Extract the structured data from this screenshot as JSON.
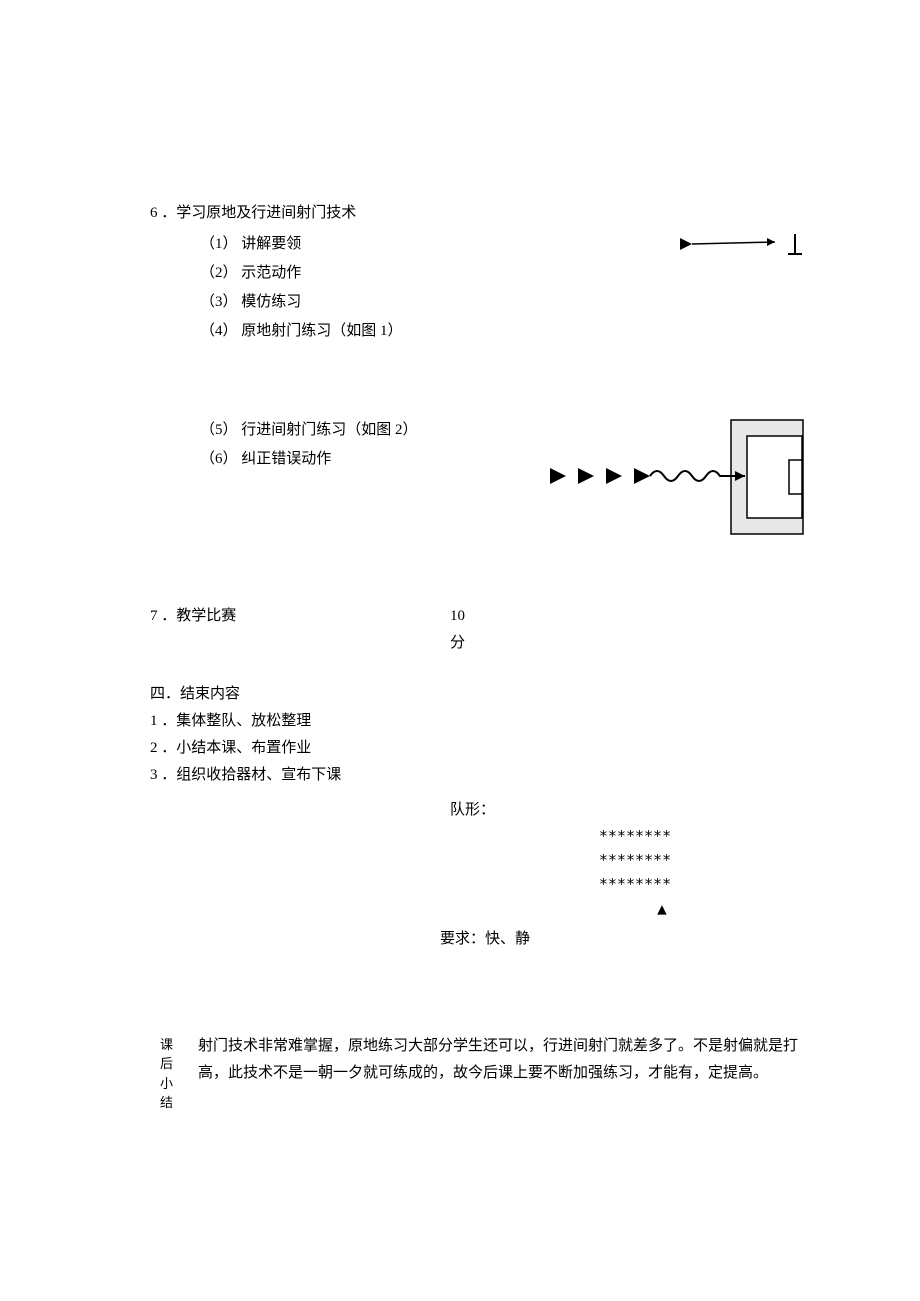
{
  "section6": {
    "heading": "6 ．学习原地及行进间射门技术",
    "items": [
      "（1） 讲解要领",
      "（2） 示范动作",
      "（3） 模仿练习",
      "（4） 原地射门练习（如图 1）",
      "（5） 行进间射门练习（如图 2）",
      "（6） 纠正错误动作"
    ]
  },
  "section7": {
    "label": "7 ．教学比赛",
    "timeValue": "10",
    "timeUnit": "分"
  },
  "section4": {
    "heading": "四．结束内容",
    "items": [
      "1 ．集体整队、放松整理",
      "2 ．小结本课、布置作业",
      "3 ．组织收拾器材、宣布下课"
    ]
  },
  "formation": {
    "label": "队形：",
    "row1": "********",
    "row2": "********",
    "row3": "********",
    "mark": "▲"
  },
  "requirement": {
    "text": "要求：快、静"
  },
  "summary": {
    "label": "课后小结",
    "text": "射门技术非常难掌握，原地练习大部分学生还可以，行进间射门就差多了。不是射偏就是打高，此技术不是一朝一夕就可练成的，故今后课上要不断加强练习，才能有，定提高。"
  }
}
